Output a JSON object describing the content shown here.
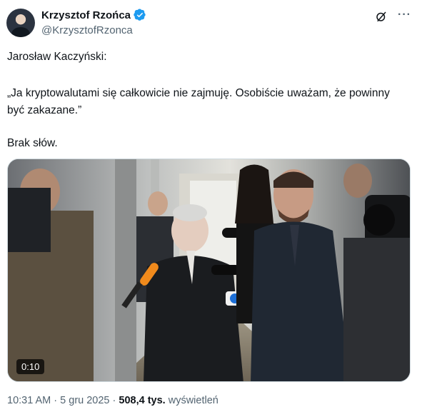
{
  "author": {
    "name": "Krzysztof Rzońca",
    "handle": "@KrzysztofRzonca",
    "verified_color": "#1d9bf0"
  },
  "tweet": {
    "line1": "Jarosław Kaczyński:",
    "line2": "„Ja kryptowalutami się całkowicie nie zajmuję. Osobiście uważam, że powinny być zakazane.”",
    "line3": "Brak słów."
  },
  "media": {
    "duration": "0:10"
  },
  "meta": {
    "time": "10:31 AM",
    "sep1": " · ",
    "date": "5 gru 2025",
    "sep2": " · ",
    "views": "508,4 tys.",
    "views_label": " wyświetleń"
  },
  "icons": {
    "grok": "grok-icon",
    "more": "more-icon",
    "verified": "verified-badge-icon"
  }
}
